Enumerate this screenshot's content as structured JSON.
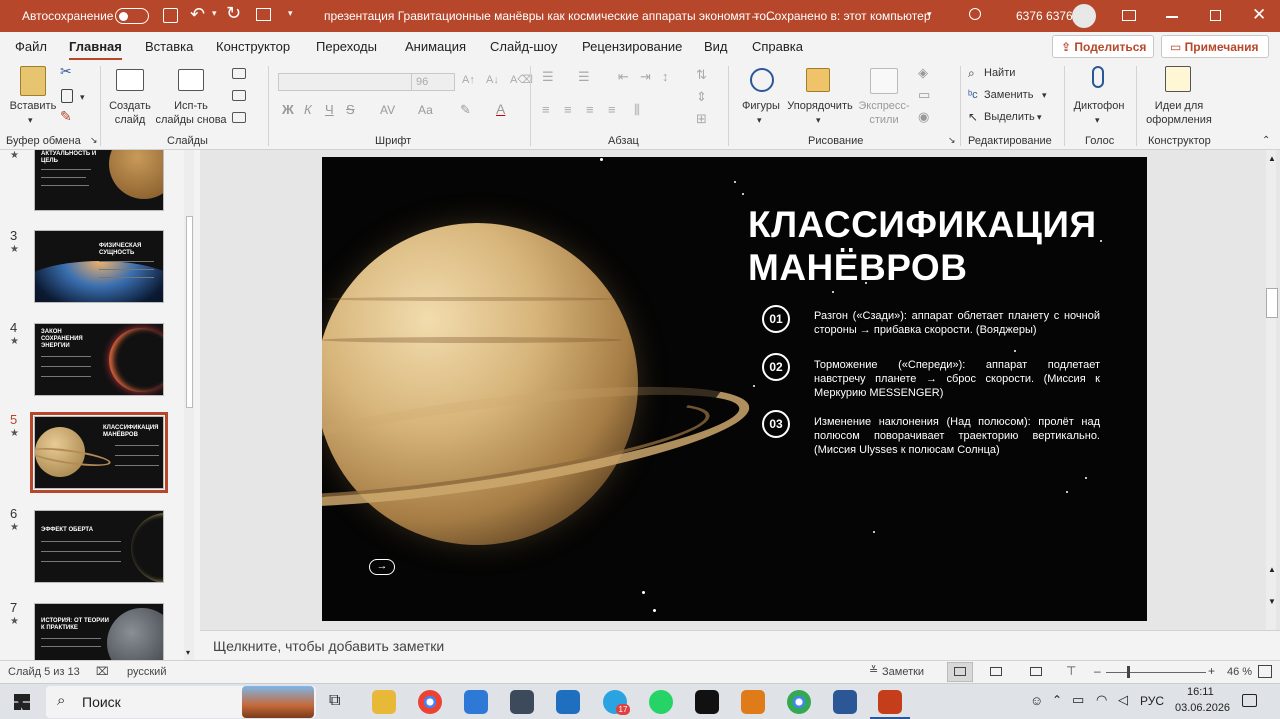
{
  "titlebar": {
    "autosave_label": "Автосохранение",
    "autosave_state": "Откл.",
    "doc_title": "презентация Гравитационные манёвры как космические аппараты экономят то...",
    "saved_status": "Сохранено в: этот компьютер",
    "user_name": "6376 6376"
  },
  "tabs": [
    "Файл",
    "Главная",
    "Вставка",
    "Конструктор",
    "Переходы",
    "Анимация",
    "Слайд-шоу",
    "Рецензирование",
    "Вид",
    "Справка"
  ],
  "share_label": "Поделиться",
  "comments_label": "Примечания",
  "ribbon": {
    "paste": "Вставить",
    "new_slide_1": "Создать",
    "new_slide_2": "слайд",
    "reuse_1": "Исп-ть",
    "reuse_2": "слайды снова",
    "font_size": "96",
    "shapes": "Фигуры",
    "arrange": "Упорядочить",
    "styles_1": "Экспресс-",
    "styles_2": "стили",
    "find": "Найти",
    "replace": "Заменить",
    "select": "Выделить",
    "dictate": "Диктофон",
    "designer_1": "Идеи для",
    "designer_2": "оформления",
    "groups": {
      "clipboard": "Буфер обмена",
      "slides": "Слайды",
      "font": "Шрифт",
      "paragraph": "Абзац",
      "drawing": "Рисование",
      "editing": "Редактирование",
      "voice": "Голос",
      "designer": "Конструктор"
    },
    "font_letters": {
      "bold": "Ж",
      "italic": "К",
      "underline": "Ч",
      "strike": "S",
      "spacing": "AV",
      "case": "Аа"
    }
  },
  "thumbnails": [
    {
      "num": "",
      "title": "АКТУАЛЬНОСТЬ И ЦЕЛЬ"
    },
    {
      "num": "3",
      "title": "ФИЗИЧЕСКАЯ СУЩНОСТЬ"
    },
    {
      "num": "4",
      "title": "ЗАКОН СОХРАНЕНИЯ ЭНЕРГИИ"
    },
    {
      "num": "5",
      "title": "КЛАССИФИКАЦИЯ МАНЁВРОВ"
    },
    {
      "num": "6",
      "title": "ЭФФЕКТ ОБЕРТА"
    },
    {
      "num": "7",
      "title": "ИСТОРИЯ: ОТ ТЕОРИИ К ПРАКТИКЕ"
    }
  ],
  "thumb_star": "★",
  "slide": {
    "heading_1": "КЛАССИФИКАЦИЯ",
    "heading_2": "МАНЁВРОВ",
    "items": [
      {
        "num": "01",
        "text": "Разгон («Сзади»): аппарат облетает планету с ночной стороны → прибавка скорости. (Вояджеры)"
      },
      {
        "num": "02",
        "text": "Торможение («Спереди»): аппарат подлетает навстречу планете → сброс скорости. (Миссия к Меркурию MESSENGER)"
      },
      {
        "num": "03",
        "text": "Изменение наклонения (Над полюсом): пролёт над полюсом поворачивает траекторию вертикально. (Миссия Ulysses к полюсам Солнца)"
      }
    ],
    "arrow": "→"
  },
  "notes_placeholder": "Щелкните, чтобы добавить заметки",
  "status": {
    "slide_counter": "Слайд 5 из 13",
    "language": "русский",
    "notes_btn": "Заметки",
    "zoom": "46 %"
  },
  "taskbar": {
    "search": "Поиск",
    "lang": "РУС",
    "time": "16:11",
    "date": "03.06.2026",
    "telegram_badge": "17"
  },
  "colors": {
    "accent": "#b7472a",
    "slide_bg": "#050505"
  }
}
